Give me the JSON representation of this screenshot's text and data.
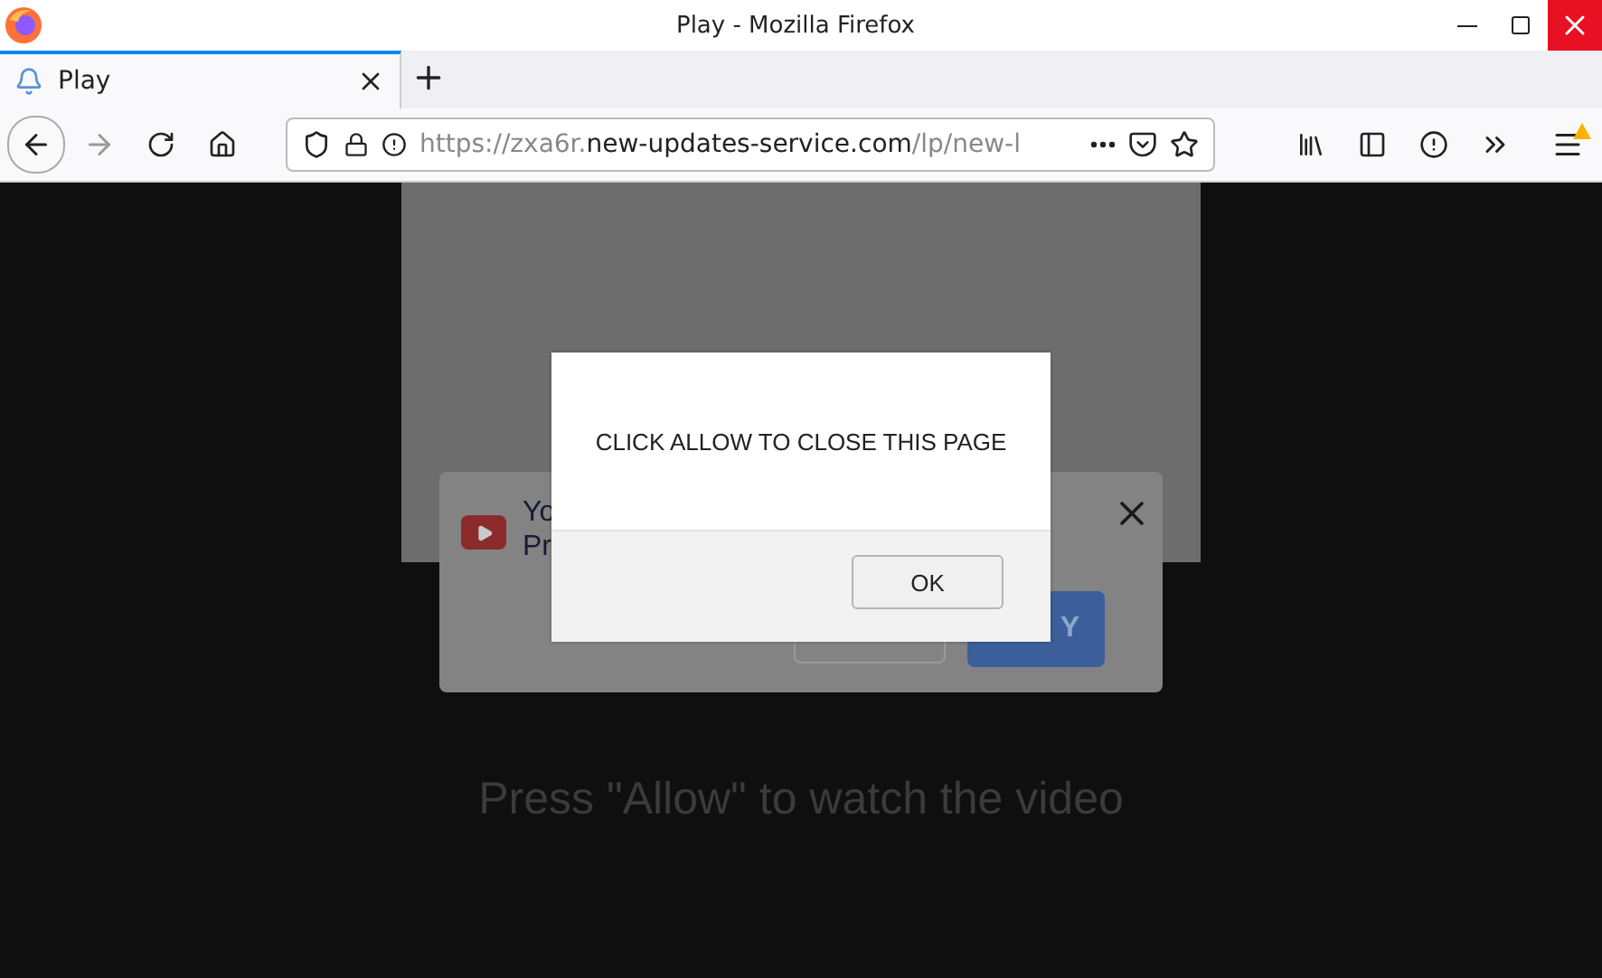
{
  "window": {
    "title": "Play - Mozilla Firefox"
  },
  "tabs": [
    {
      "label": "Play",
      "selected": true
    }
  ],
  "address_bar": {
    "scheme": "https://zxa6r.",
    "domain": "new-updates-service.com",
    "path": "/lp/new-l"
  },
  "notification": {
    "line_1": "Yo",
    "line_2": "Pr",
    "button_label": "Y"
  },
  "dialog": {
    "message": "CLICK ALLOW TO CLOSE THIS PAGE",
    "button": "OK"
  },
  "page_text": "Press \"Allow\" to watch the video"
}
